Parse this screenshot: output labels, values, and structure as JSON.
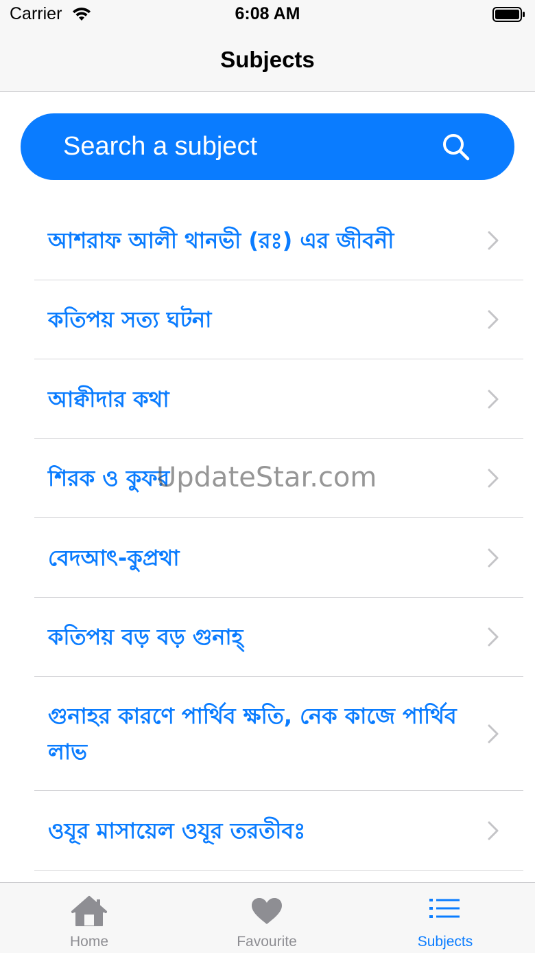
{
  "status_bar": {
    "carrier": "Carrier",
    "time": "6:08 AM"
  },
  "nav": {
    "title": "Subjects"
  },
  "search": {
    "placeholder": "Search a subject"
  },
  "subjects": [
    "আশরাফ আলী থানভী (রঃ) এর জীবনী",
    "কতিপয় সত্য ঘটনা",
    "আক্বীদার কথা",
    "শিরক ও কুফর",
    "বেদআৎ-কুপ্রথা",
    "কতিপয় বড় বড় গুনাহ্",
    "গুনাহর কারণে পার্থিব ক্ষতি, নেক কাজে পার্থিব লাভ",
    "ওযূর মাসায়েল ওযূর তরতীবঃ"
  ],
  "watermark": "UpdateStar.com",
  "tabs": [
    {
      "label": "Home",
      "icon": "home-icon",
      "active": false
    },
    {
      "label": "Favourite",
      "icon": "heart-icon",
      "active": false
    },
    {
      "label": "Subjects",
      "icon": "list-icon",
      "active": true
    }
  ],
  "colors": {
    "accent": "#0a7cff",
    "inactive": "#8e8e93",
    "bar_bg": "#f7f7f7"
  }
}
